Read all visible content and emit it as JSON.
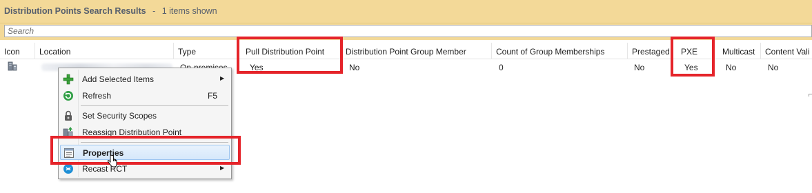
{
  "title_bar": {
    "title": "Distribution Points Search Results",
    "separator": "-",
    "count": "1 items shown"
  },
  "search": {
    "placeholder": "Search"
  },
  "columns": [
    "Icon",
    "Location",
    "Type",
    "Pull Distribution Point",
    "Distribution Point Group Member",
    "Count of Group Memberships",
    "Prestaged",
    "PXE",
    "Multicast",
    "Content Vali"
  ],
  "rows": [
    {
      "icon": "server-icon",
      "location": "",
      "type": "On-premises",
      "pull_distribution_point": "Yes",
      "group_member": "No",
      "group_memberships": "0",
      "prestaged": "No",
      "pxe": "Yes",
      "multicast": "No",
      "content_validation": "No"
    }
  ],
  "context_menu": {
    "items": [
      {
        "label": "Add Selected Items",
        "icon": "add-icon",
        "has_submenu": true
      },
      {
        "label": "Refresh",
        "icon": "refresh-icon",
        "shortcut": "F5"
      },
      {
        "label": "Set Security Scopes",
        "icon": "lock-icon"
      },
      {
        "label": "Reassign Distribution Point",
        "icon": "reassign-icon"
      },
      {
        "label": "Properties",
        "icon": "properties-icon",
        "selected": true
      },
      {
        "label": "Recast RCT",
        "icon": "recast-icon",
        "has_submenu": true
      }
    ]
  },
  "colors": {
    "header_band": "#f3d998",
    "highlight_border": "#e5242a",
    "menu_selection": "#d6e8fb"
  }
}
